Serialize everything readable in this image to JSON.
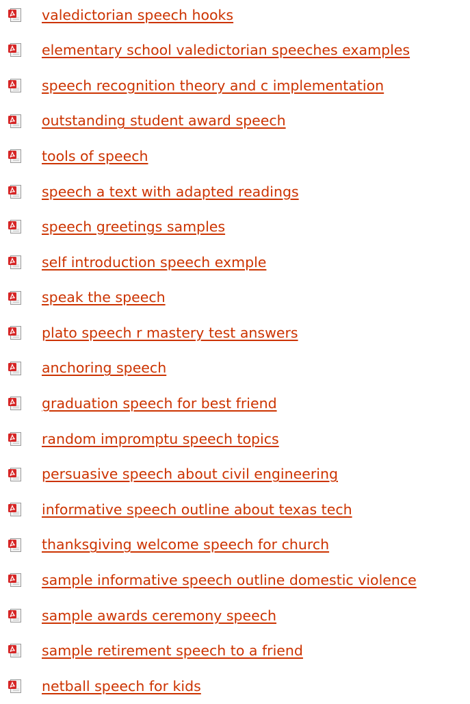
{
  "colors": {
    "link": "#cc3300",
    "icon_red": "#d62525",
    "icon_paper": "#f2f2f2",
    "background": "#ffffff"
  },
  "icon": "pdf-file-icon",
  "links": [
    {
      "label": "valedictorian speech hooks"
    },
    {
      "label": "elementary school valedictorian speeches examples"
    },
    {
      "label": "speech recognition theory and c implementation"
    },
    {
      "label": "outstanding student award speech"
    },
    {
      "label": "tools of speech"
    },
    {
      "label": "speech a text with adapted readings"
    },
    {
      "label": "speech greetings samples"
    },
    {
      "label": "self introduction speech exmple"
    },
    {
      "label": "speak the speech"
    },
    {
      "label": "plato speech r mastery test answers"
    },
    {
      "label": "anchoring speech"
    },
    {
      "label": "graduation speech for best friend"
    },
    {
      "label": "random impromptu speech topics"
    },
    {
      "label": "persuasive speech about civil engineering"
    },
    {
      "label": "informative speech outline about texas tech"
    },
    {
      "label": "thanksgiving welcome speech for church"
    },
    {
      "label": "sample informative speech outline domestic violence"
    },
    {
      "label": "sample awards ceremony speech"
    },
    {
      "label": "sample retirement speech to a friend"
    },
    {
      "label": "netball speech for kids"
    }
  ]
}
